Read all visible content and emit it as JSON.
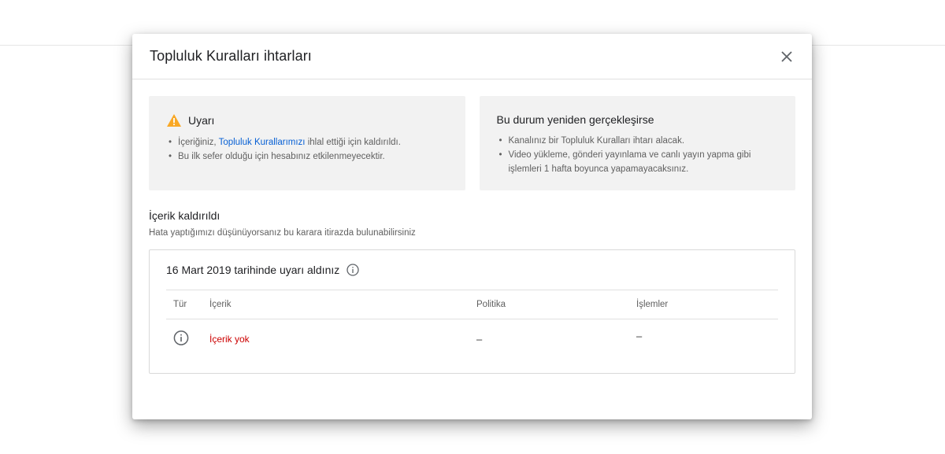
{
  "dialog": {
    "title": "Topluluk Kuralları ihtarları",
    "close_icon": "close-icon"
  },
  "warning_card": {
    "heading": "Uyarı",
    "icon": "warning-triangle-icon",
    "icon_color": "#f9a825",
    "bullet1_prefix": "İçeriğiniz, ",
    "bullet1_link": "Topluluk Kurallarımızı",
    "bullet1_suffix": " ihlal ettiği için kaldırıldı.",
    "bullet2": "Bu ilk sefer olduğu için hesabınız etkilenmeyecektir.",
    "link_color": "#065fd4"
  },
  "repeat_card": {
    "heading": "Bu durum yeniden gerçekleşirse",
    "bullet1": "Kanalınız bir Topluluk Kuralları ihtarı alacak.",
    "bullet2": "Video yükleme, gönderi yayınlama ve canlı yayın yapma gibi işlemleri 1 hafta boyunca yapamayacaksınız."
  },
  "content_removed": {
    "title": "İçerik kaldırıldı",
    "subtitle": "Hata yaptığımızı düşünüyorsanız bu karara itirazda bulunabilirsiniz"
  },
  "strike": {
    "heading": "16 Mart 2019 tarihinde uyarı aldınız",
    "heading_icon": "info-icon",
    "columns": {
      "type": "Tür",
      "content": "İçerik",
      "policy": "Politika",
      "actions": "İşlemler"
    },
    "row": {
      "type_icon": "info-icon",
      "content": "İçerik yok",
      "content_color": "#cc0000",
      "policy": "–",
      "actions": "–"
    }
  }
}
